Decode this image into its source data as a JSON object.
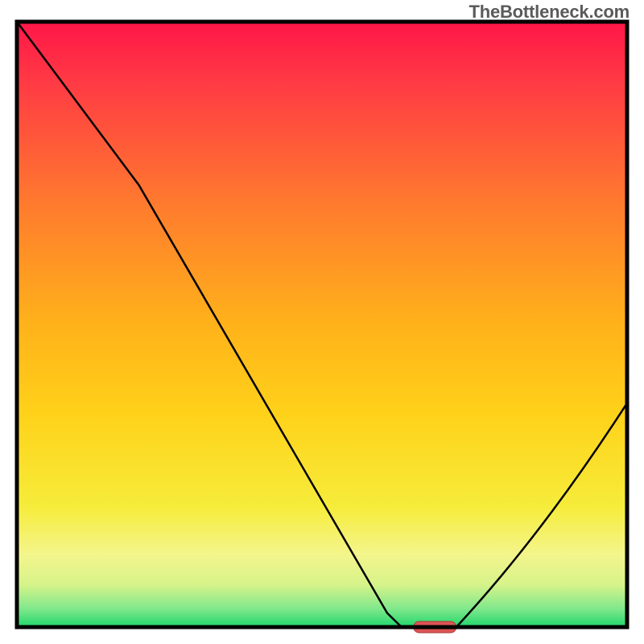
{
  "attribution": "TheBottleneck.com",
  "colors": {
    "border": "#000000",
    "curve": "#000000",
    "marker_fill": "#dd5555",
    "marker_stroke": "#aa3a3a",
    "gradient_top": "#ff1648",
    "gradient_mid": "#ffc400",
    "gradient_low": "#f9f97a",
    "gradient_bottom": "#1fd66b"
  },
  "chart_data": {
    "type": "line",
    "title": "",
    "xlabel": "",
    "ylabel": "",
    "xlim": [
      0,
      100
    ],
    "ylim": [
      0,
      100
    ],
    "x": [
      0,
      20,
      62,
      68,
      72,
      100
    ],
    "values": [
      100,
      73,
      1,
      0,
      0,
      37
    ],
    "marker": {
      "x0": 65,
      "x1": 72,
      "y": 0
    },
    "annotations": []
  }
}
